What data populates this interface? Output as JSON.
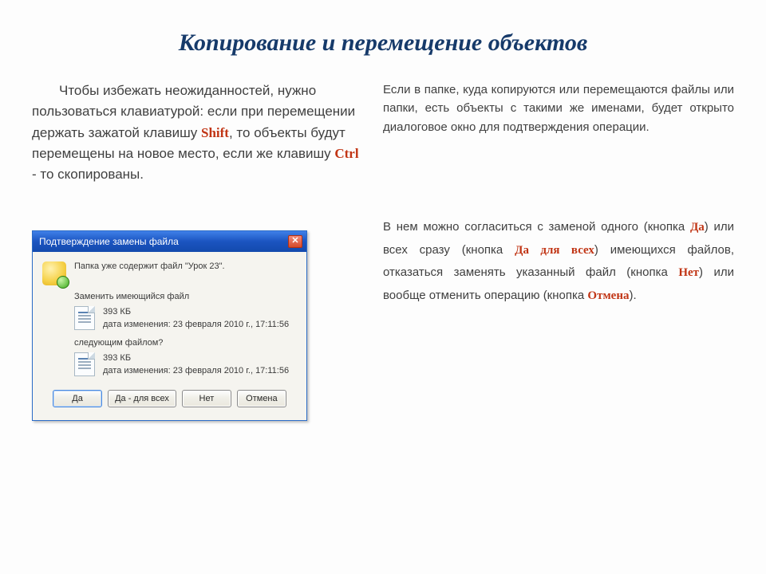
{
  "title": "Копирование и перемещение объектов",
  "left": {
    "before_shift": "Чтобы избежать неожиданностей, нужно пользоваться клавиатурой: если при перемещении держать зажатой клавишу ",
    "kw_shift": "Shift",
    "mid": ", то объекты будут перемещены на новое место, если же клавишу ",
    "kw_ctrl": "Ctrl",
    "after_ctrl": " - то скопированы."
  },
  "right1": "Если в папке, куда копируются или перемещаются файлы или папки, есть объекты с такими же именами, будет открыто диалоговое окно для подтверждения операции.",
  "right2": {
    "a": "В нем можно согласиться с заменой одного (кнопка ",
    "kw_da": "Да",
    "b": ") или всех сразу (кнопка ",
    "kw_da_all": "Да для всех",
    "c": ") имеющихся файлов, отказаться заменять указанный файл (кнопка ",
    "kw_net": "Нет",
    "d": ") или вообще отменить операцию (кнопка ",
    "kw_cancel": "Отмена",
    "e": ")."
  },
  "dialog": {
    "title": "Подтверждение замены файла",
    "line1": "Папка уже содержит файл \"Урок 23\".",
    "q1": "Заменить имеющийся файл",
    "file_size": "393 КБ",
    "file_date": "дата изменения: 23 февраля 2010 г., 17:11:56",
    "q2": "следующим файлом?",
    "btn_yes": "Да",
    "btn_yes_all": "Да - для всех",
    "btn_no": "Нет",
    "btn_cancel": "Отмена"
  }
}
